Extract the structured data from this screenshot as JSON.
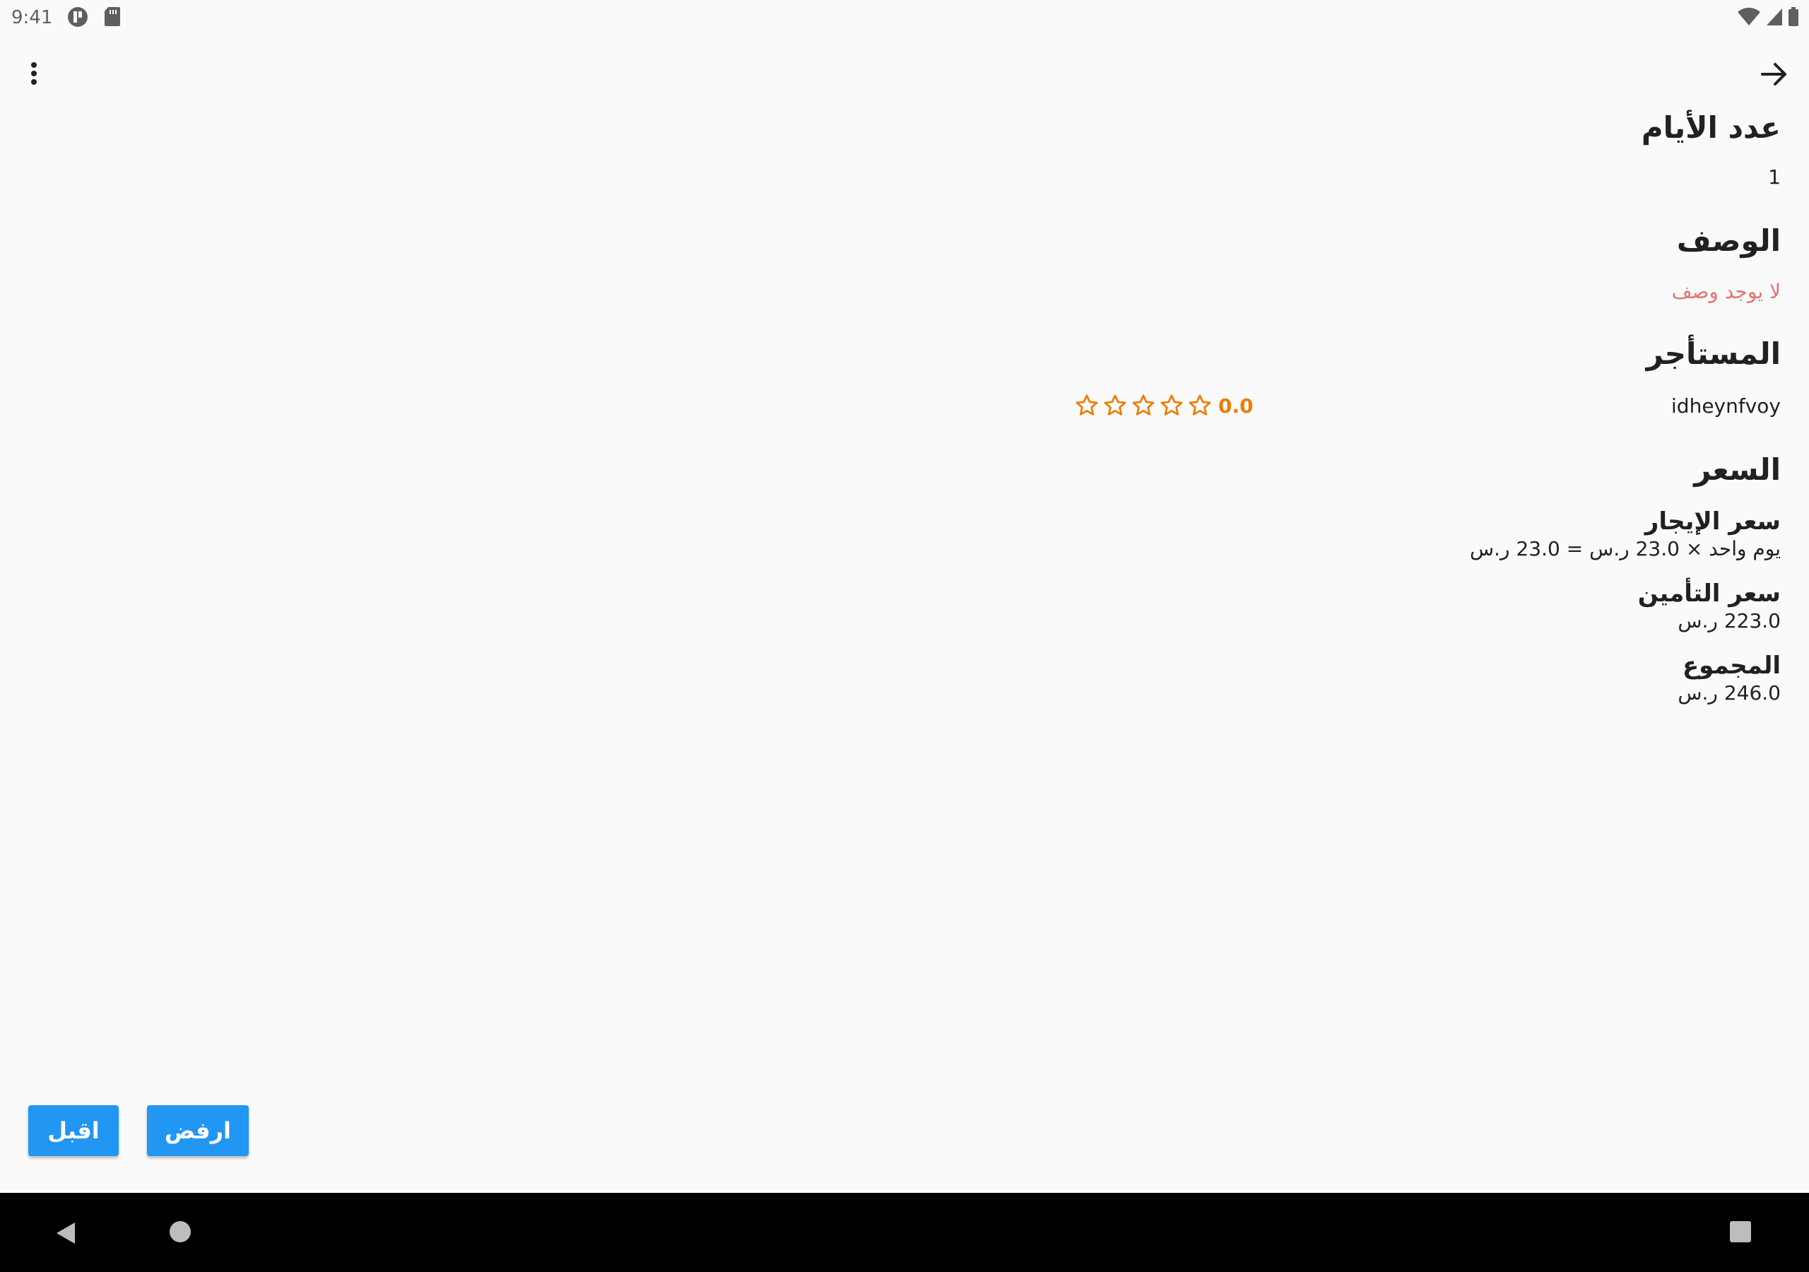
{
  "status_bar": {
    "time": "9:41",
    "left_icons": [
      "notification-app-icon",
      "sd-card-icon"
    ],
    "right_icons": [
      "wifi-icon",
      "signal-icon",
      "battery-icon"
    ]
  },
  "app_bar": {
    "menu_icon": "more-vert-icon",
    "back_icon": "arrow-forward-icon"
  },
  "details": {
    "days_title": "عدد الأيام",
    "days_value": "1",
    "description_title": "الوصف",
    "description_value": "لا يوجد وصف",
    "renter_title": "المستأجر",
    "renter_name": "idheynfvoy",
    "renter_rating": "0.0",
    "renter_stars": 0,
    "price_title": "السعر",
    "rent_price_title": "سعر الإيجار",
    "rent_price_value": "يوم واحد × 23.0 ر.س = 23.0 ر.س",
    "insurance_title": "سعر التأمين",
    "insurance_value": "223.0 ر.س",
    "total_title": "المجموع",
    "total_value": "246.0 ر.س"
  },
  "actions": {
    "accept_label": "اقبل",
    "reject_label": "ارفض"
  },
  "colors": {
    "accent": "#2196f3",
    "rating": "#ef7c00",
    "empty_description": "#e57373",
    "background": "#fafafa"
  },
  "nav_bar": {
    "icons": [
      "nav-back-icon",
      "nav-home-icon",
      "nav-recents-icon"
    ]
  }
}
